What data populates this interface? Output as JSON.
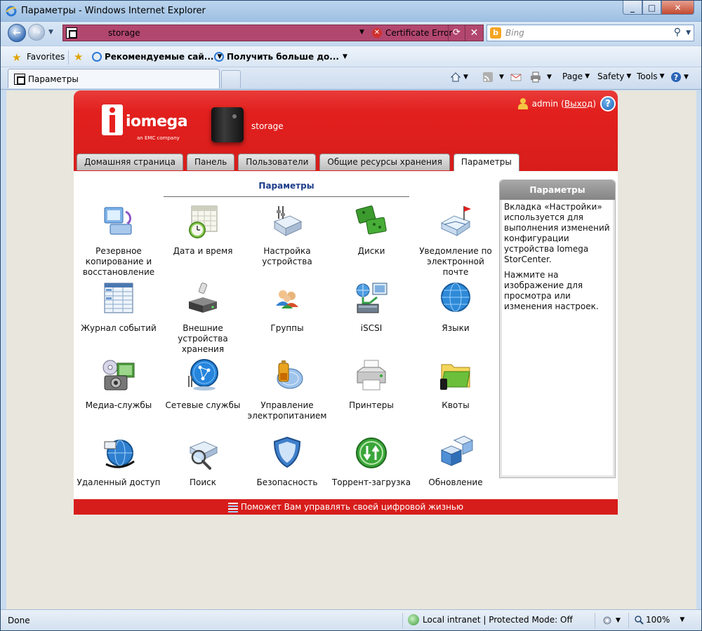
{
  "window": {
    "title": "Параметры - Windows Internet Explorer"
  },
  "address": {
    "url": "storage",
    "cert_error": "Certificate Error"
  },
  "search": {
    "placeholder": "Bing"
  },
  "favorites": {
    "label": "Favorites",
    "links": [
      "Рекомендуемые сай...",
      "Получить больше до..."
    ]
  },
  "browser_tab": {
    "label": "Параметры"
  },
  "commands": {
    "page": "Page",
    "safety": "Safety",
    "tools": "Tools"
  },
  "status": {
    "text": "Done",
    "zone": "Local intranet | Protected Mode: Off",
    "zoom": "100%"
  },
  "app": {
    "brand": "iomega",
    "brand_sub": "an EMC company",
    "device_name": "storage",
    "user": "admin",
    "logout": "Выход",
    "tabs": [
      "Домашняя страница",
      "Панель",
      "Пользователи",
      "Общие ресурсы хранения",
      "Параметры"
    ],
    "section_title": "Параметры",
    "items": [
      "Резервное копирование и восстановление",
      "Дата и время",
      "Настройка устройства",
      "Диски",
      "Уведомление по электронной почте",
      "Журнал событий",
      "Внешние устройства хранения",
      "Группы",
      "iSCSI",
      "Языки",
      "Медиа-службы",
      "Сетевые службы",
      "Управление электропитанием",
      "Принтеры",
      "Квоты",
      "Удаленный доступ",
      "Поиск",
      "Безопасность",
      "Торрент-загрузка",
      "Обновление"
    ],
    "side": {
      "title": "Параметры",
      "p1": "Вкладка «Настройки» используется для выполнения изменений конфигурации устройства Iomega StorCenter.",
      "p2": "Нажмите на изображение для просмотра или изменения настроек."
    },
    "footer": "Поможет Вам управлять своей цифровой жизнью"
  }
}
